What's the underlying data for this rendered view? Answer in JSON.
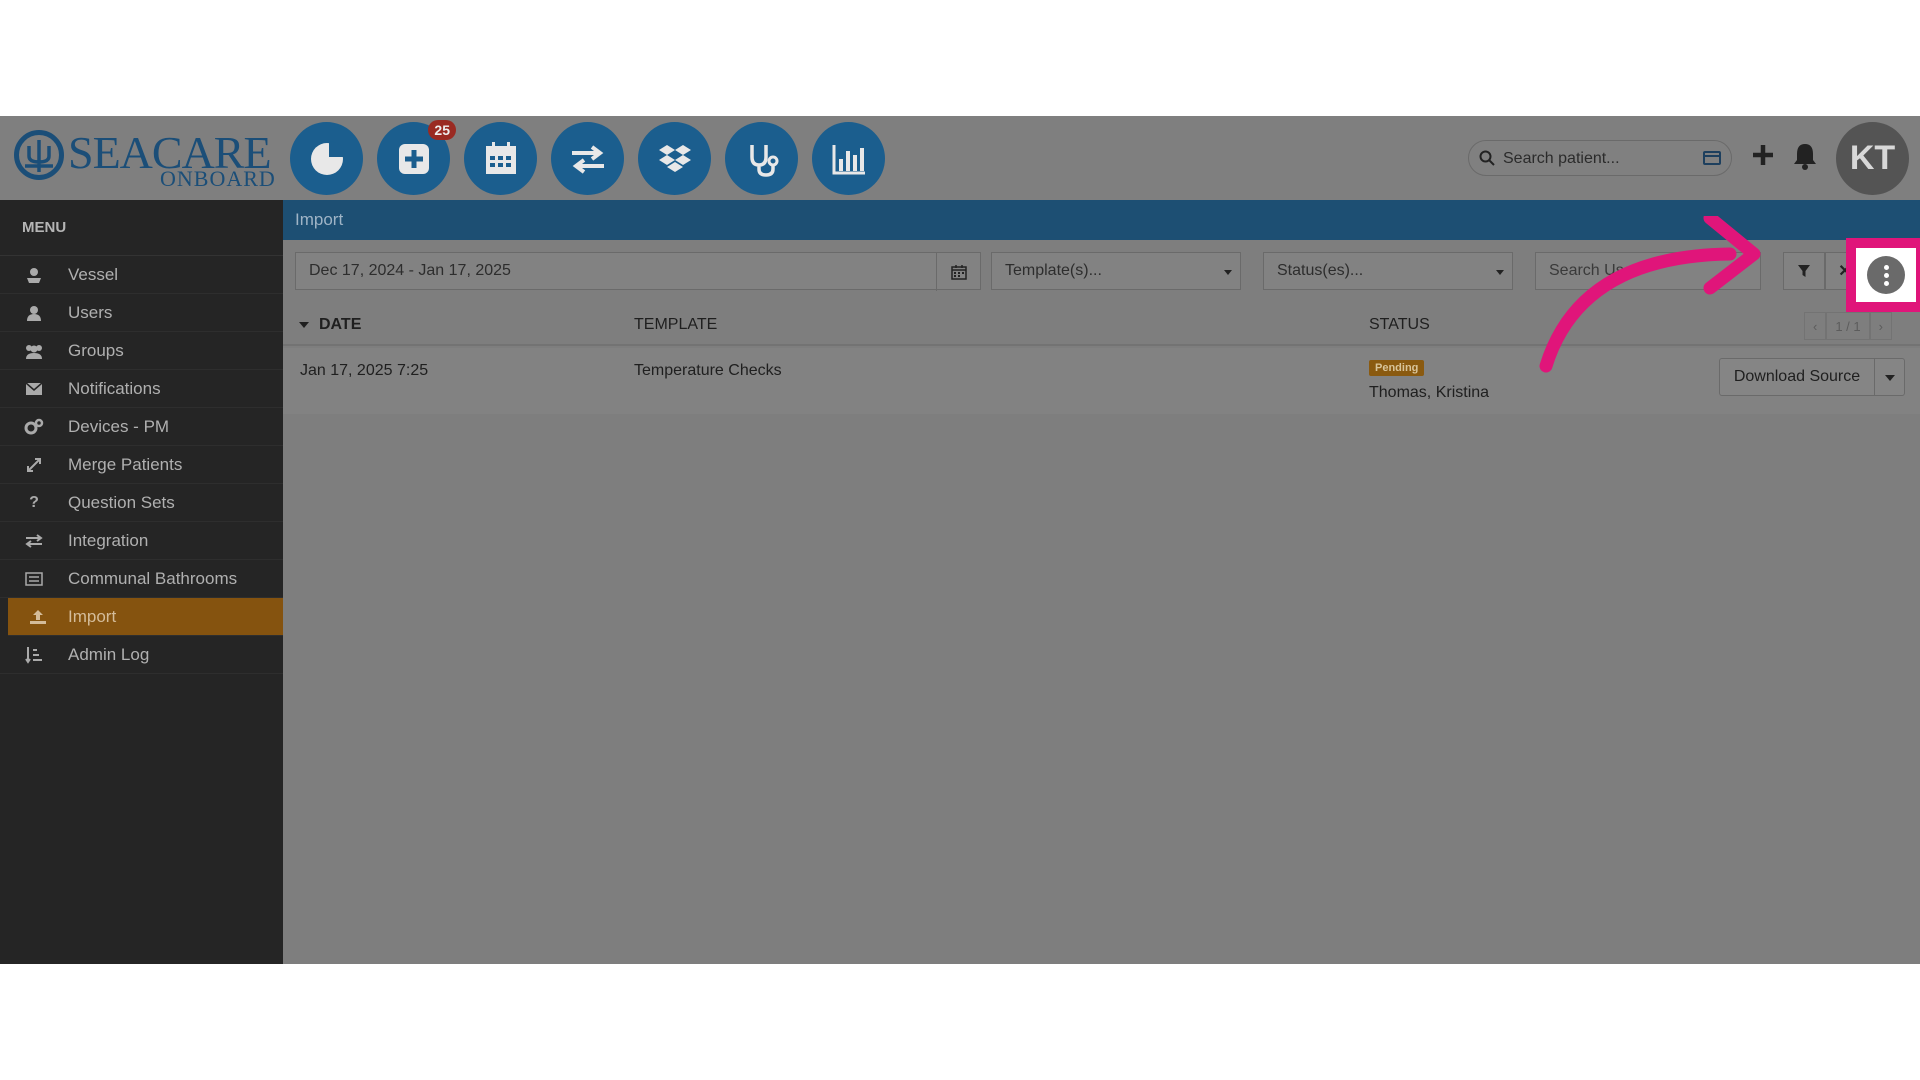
{
  "app": {
    "logo_main": "SEACARE",
    "logo_sub": "ONBOARD",
    "brand_color": "#1b5e8e",
    "accent_color": "#85530f",
    "highlight_color": "#e0157a"
  },
  "topnav": {
    "buttons": [
      {
        "icon": "pie-chart-icon"
      },
      {
        "icon": "medical-plus-icon",
        "badge": "25"
      },
      {
        "icon": "calendar-icon"
      },
      {
        "icon": "transfer-arrows-icon"
      },
      {
        "icon": "dropbox-icon"
      },
      {
        "icon": "stethoscope-icon"
      },
      {
        "icon": "bar-chart-icon"
      }
    ],
    "search_placeholder": "Search patient...",
    "avatar_initials": "KT"
  },
  "sidebar": {
    "title": "MENU",
    "items": [
      {
        "label": "Vessel",
        "icon": "vessel-icon"
      },
      {
        "label": "Users",
        "icon": "user-icon"
      },
      {
        "label": "Groups",
        "icon": "groups-icon"
      },
      {
        "label": "Notifications",
        "icon": "envelope-icon"
      },
      {
        "label": "Devices - PM",
        "icon": "gears-icon"
      },
      {
        "label": "Merge Patients",
        "icon": "merge-icon"
      },
      {
        "label": "Question Sets",
        "icon": "question-icon"
      },
      {
        "label": "Integration",
        "icon": "exchange-icon"
      },
      {
        "label": "Communal Bathrooms",
        "icon": "list-icon"
      },
      {
        "label": "Import",
        "icon": "upload-icon",
        "active": true
      },
      {
        "label": "Admin Log",
        "icon": "sort-list-icon"
      }
    ]
  },
  "main": {
    "breadcrumb": "Import",
    "filters": {
      "date_range": "Dec 17, 2024 - Jan 17, 2025",
      "template_placeholder": "Template(s)...",
      "status_placeholder": "Status(es)...",
      "user_search_placeholder": "Search User"
    },
    "table": {
      "columns": [
        "DATE",
        "TEMPLATE",
        "STATUS"
      ],
      "pager": {
        "prev": "‹",
        "label": "1 / 1",
        "next": "›"
      },
      "rows": [
        {
          "date": "Jan 17, 2025 7:25",
          "template": "Temperature Checks",
          "status": "Pending",
          "user": "Thomas, Kristina",
          "action": "Download Source"
        }
      ]
    }
  }
}
